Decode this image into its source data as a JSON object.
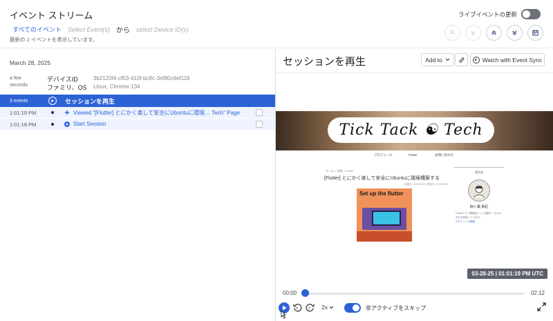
{
  "header": {
    "title": "イベント ストリーム",
    "filters": {
      "all_events": "すべてのイベント",
      "select_events": "Select Event(s)",
      "from": "から",
      "select_devices": "select Device ID(s)"
    },
    "subtitle": "最新の 2 イベントを表示しています。",
    "live_label": "ライブイベントの更新",
    "buttons": [
      "scroll-top-icon",
      "scroll-bottom-icon",
      "expand-all-icon",
      "collapse-all-icon",
      "calendar-icon"
    ]
  },
  "left": {
    "date": "March 28, 2025",
    "device": {
      "ago": "a few seconds",
      "key_device": "デバイスID",
      "key_family": "ファミリ、OS",
      "device_id": "3b2120f4-cf03-410f-bc8c-3ef80c8ef118",
      "os": "Linux, Chrome 134"
    },
    "session_header": {
      "count": "3 events",
      "title": "セッションを再生"
    },
    "events": [
      {
        "time": "1:01:19 PM",
        "text": "Viewed \"[Flutter] とにかく楽して安全にUbuntuに環境… Tech\" Page",
        "icon": "page-view-icon"
      },
      {
        "time": "1:01:18 PM",
        "text": "Start Session",
        "icon": "start-session-icon"
      }
    ]
  },
  "right": {
    "title": "セッションを再生",
    "add_to": "Add to",
    "watch_sync": "Watch with Event Sync",
    "recording": {
      "logo": "Tick Tack ☯ Tech",
      "nav": [
        "プロフィール",
        "Flutter",
        "お問い合わせ"
      ],
      "breadcrumb": "ホーム > 技術 > Flutter",
      "post_title": "[Flutter] とにかく楽して安全にUbuntuに環境構築する",
      "post_meta": "投稿日: 2025/03/20 | 更新日: 2025/03/20",
      "post_image_title": "Set up the flutter",
      "side_heading": "運営者",
      "side_name": "柳ヶ瀬 貴紀",
      "side_text": "Flutterアプリ開発者として活動中。日々の学びを発信しています。",
      "side_link": "プロフィール詳細"
    },
    "timestamp": "03-28-25 | 01:01:19 PM UTC",
    "time_start": "00:00",
    "time_end": "02:12",
    "progress": 0.0,
    "speed": "2x",
    "skip_label": "非アクティブをスキップ",
    "skip_inactive": true
  }
}
